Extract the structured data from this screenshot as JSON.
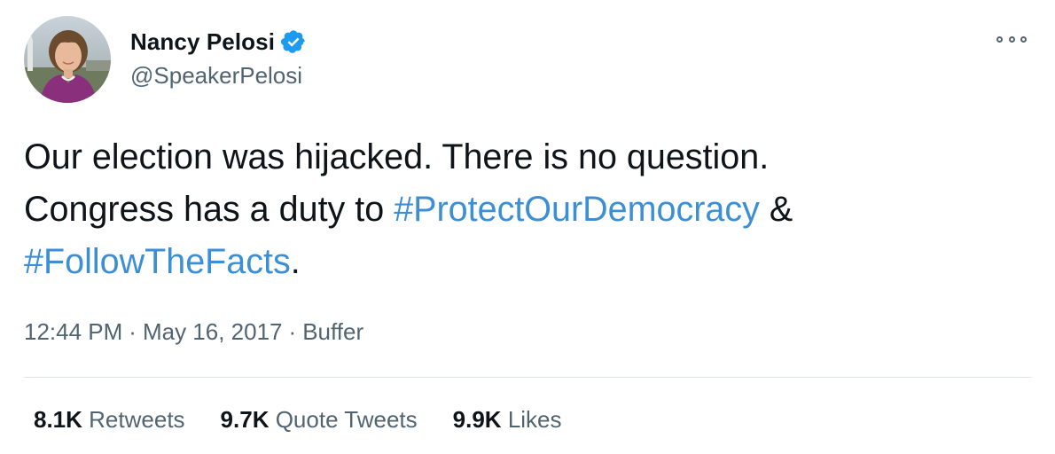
{
  "author": {
    "display_name": "Nancy Pelosi",
    "handle": "@SpeakerPelosi",
    "verified": true,
    "avatar_icon": "profile-photo"
  },
  "tweet": {
    "line1": "Our election was hijacked. There is no question.",
    "line2_prefix": "Congress has a duty to ",
    "hashtag1": "#ProtectOurDemocracy",
    "line2_suffix": " &",
    "hashtag2": "#FollowTheFacts",
    "line3_suffix": "."
  },
  "meta": {
    "time": "12:44 PM",
    "separator": "·",
    "date": "May 16, 2017",
    "source": "Buffer"
  },
  "stats": {
    "retweets_count": "8.1K",
    "retweets_label": "Retweets",
    "quotes_count": "9.7K",
    "quotes_label": "Quote Tweets",
    "likes_count": "9.9K",
    "likes_label": "Likes"
  },
  "colors": {
    "hashtag": "#3c8fd4",
    "verified_badge": "#1d9bf0",
    "secondary_text": "#536471",
    "primary_text": "#0f1419"
  },
  "icons": {
    "verified": "verified-badge-icon",
    "more": "more-options-icon"
  }
}
